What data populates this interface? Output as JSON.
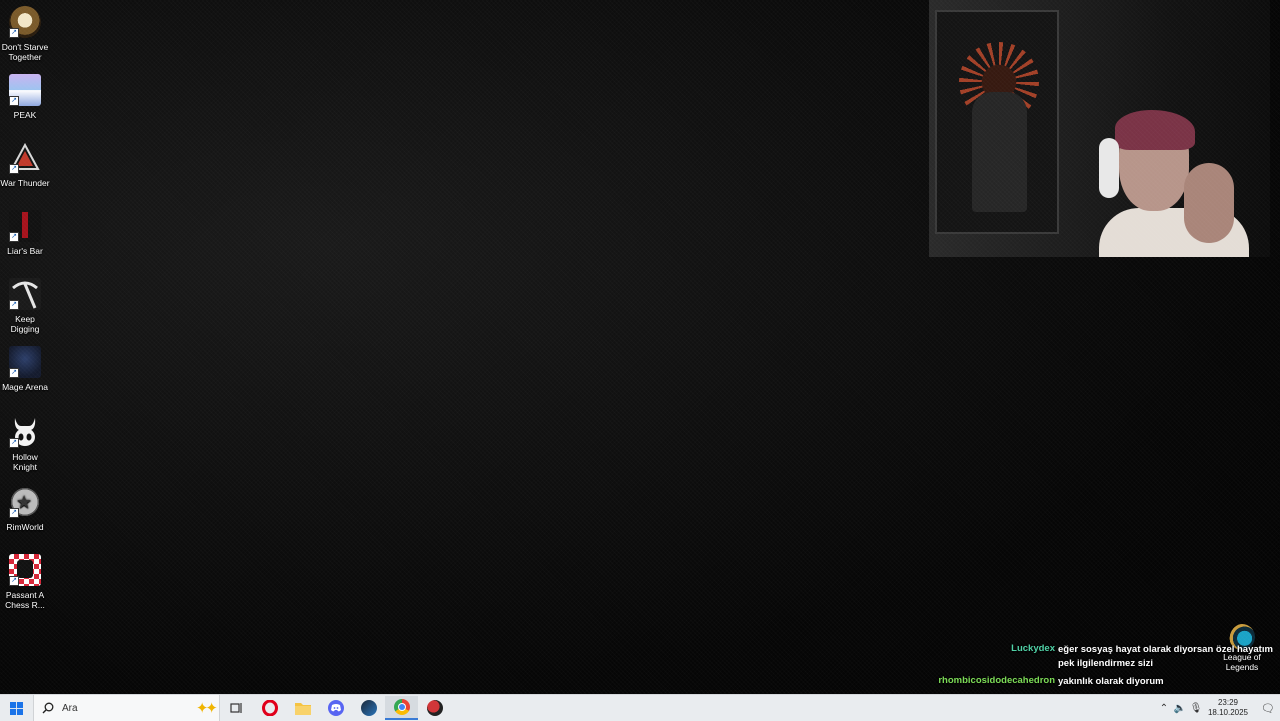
{
  "desktop_icons": [
    {
      "label": "Don't Starve Together",
      "icon": "dont-starve-icon",
      "color": "#d9c39a"
    },
    {
      "label": "PEAK",
      "icon": "peak-icon",
      "color": "#b9a6e8"
    },
    {
      "label": "War Thunder",
      "icon": "war-thunder-icon",
      "color": "#c0392b"
    },
    {
      "label": "Liar's Bar",
      "icon": "liars-bar-icon",
      "color": "#8b0f16"
    },
    {
      "label": "Keep Digging",
      "icon": "pickaxe-icon",
      "color": "#cfcfcf"
    },
    {
      "label": "Mage Arena",
      "icon": "mage-arena-icon",
      "color": "#1c2a4a"
    },
    {
      "label": "Hollow Knight",
      "icon": "hollow-knight-icon",
      "color": "#f2f2f2"
    },
    {
      "label": "RimWorld",
      "icon": "rimworld-icon",
      "color": "#9a9a9a"
    },
    {
      "label": "Passant A Chess R...",
      "icon": "chess-icon",
      "color": "#d72638"
    }
  ],
  "chat": [
    {
      "user": "Luckydex",
      "user_color": "#4fd1a6",
      "text": "eğer sosyaş hayat olarak diyorsan özel hayatım pek ilgilendirmez sizi"
    },
    {
      "user": "rhombicosidodecahedron",
      "user_color": "#7bdc55",
      "text": "yakınlık olarak diyorum"
    }
  ],
  "corner_icon": {
    "label": "League of Legends",
    "icon": "league-of-legends-icon"
  },
  "taskbar": {
    "search_placeholder": "Ara",
    "apps": [
      {
        "name": "task-view",
        "icon": "task-view-icon"
      },
      {
        "name": "opera",
        "icon": "opera-icon",
        "color": "#e0001b"
      },
      {
        "name": "file-explorer",
        "icon": "folder-icon",
        "color": "#f5c342"
      },
      {
        "name": "discord",
        "icon": "discord-icon",
        "color": "#5865f2"
      },
      {
        "name": "steam",
        "icon": "steam-icon",
        "color": "#1b2838"
      },
      {
        "name": "chrome",
        "icon": "chrome-icon",
        "color": "#34a853"
      },
      {
        "name": "riot-client",
        "icon": "riot-icon",
        "color": "#d13639"
      }
    ],
    "time": "23:29",
    "date": "18.10.2025"
  }
}
